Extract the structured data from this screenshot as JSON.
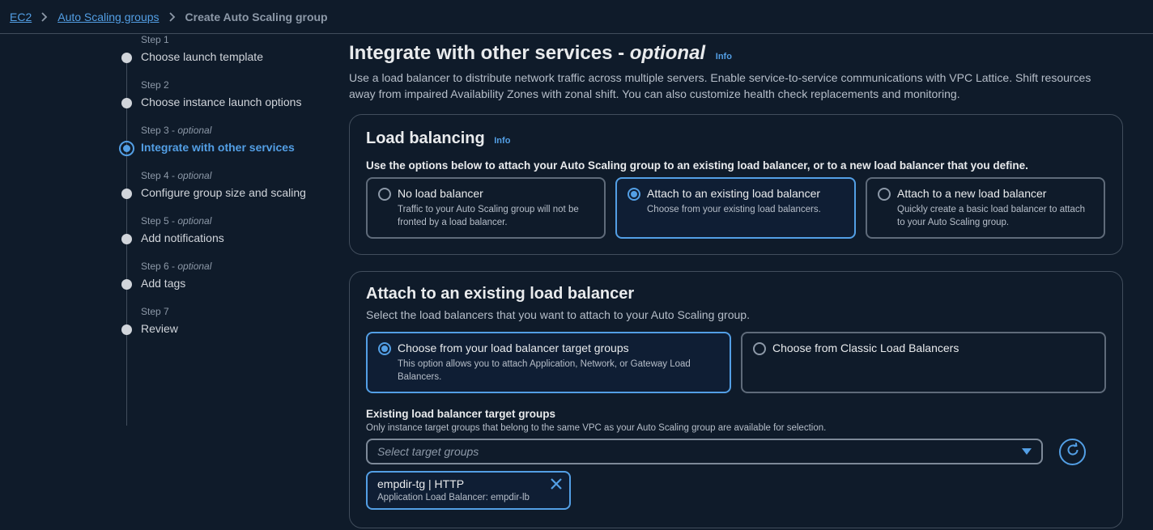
{
  "breadcrumb": {
    "items": [
      "EC2",
      "Auto Scaling groups"
    ],
    "current": "Create Auto Scaling group"
  },
  "steps": [
    {
      "num": "Step 1",
      "optional": "",
      "title": "Choose launch template"
    },
    {
      "num": "Step 2",
      "optional": "",
      "title": "Choose instance launch options"
    },
    {
      "num": "Step 3 - ",
      "optional": "optional",
      "title": "Integrate with other services"
    },
    {
      "num": "Step 4 - ",
      "optional": "optional",
      "title": "Configure group size and scaling"
    },
    {
      "num": "Step 5 - ",
      "optional": "optional",
      "title": "Add notifications"
    },
    {
      "num": "Step 6 - ",
      "optional": "optional",
      "title": "Add tags"
    },
    {
      "num": "Step 7",
      "optional": "",
      "title": "Review"
    }
  ],
  "page": {
    "title": "Integrate with other services - ",
    "title_optional": "optional",
    "info": "Info",
    "description": "Use a load balancer to distribute network traffic across multiple servers. Enable service-to-service communications with VPC Lattice. Shift resources away from impaired Availability Zones with zonal shift. You can also customize health check replacements and monitoring."
  },
  "load_balancing": {
    "title": "Load balancing",
    "info": "Info",
    "instruction": "Use the options below to attach your Auto Scaling group to an existing load balancer, or to a new load balancer that you define.",
    "options": [
      {
        "label": "No load balancer",
        "desc": "Traffic to your Auto Scaling group will not be fronted by a load balancer."
      },
      {
        "label": "Attach to an existing load balancer",
        "desc": "Choose from your existing load balancers."
      },
      {
        "label": "Attach to a new load balancer",
        "desc": "Quickly create a basic load balancer to attach to your Auto Scaling group."
      }
    ]
  },
  "attach_existing": {
    "title": "Attach to an existing load balancer",
    "subtitle": "Select the load balancers that you want to attach to your Auto Scaling group.",
    "options": [
      {
        "label": "Choose from your load balancer target groups",
        "desc": "This option allows you to attach Application, Network, or Gateway Load Balancers."
      },
      {
        "label": "Choose from Classic Load Balancers",
        "desc": ""
      }
    ],
    "target_groups_label": "Existing load balancer target groups",
    "target_groups_desc": "Only instance target groups that belong to the same VPC as your Auto Scaling group are available for selection.",
    "select_placeholder": "Select target groups",
    "token": {
      "title": "empdir-tg | HTTP",
      "desc": "Application Load Balancer: empdir-lb"
    }
  },
  "colors": {
    "accent": "#539fe5",
    "background": "#0f1b2a",
    "border": "#414d5c"
  },
  "icons": [
    "chevron-right-icon",
    "refresh-icon",
    "close-icon",
    "caret-down-icon"
  ]
}
